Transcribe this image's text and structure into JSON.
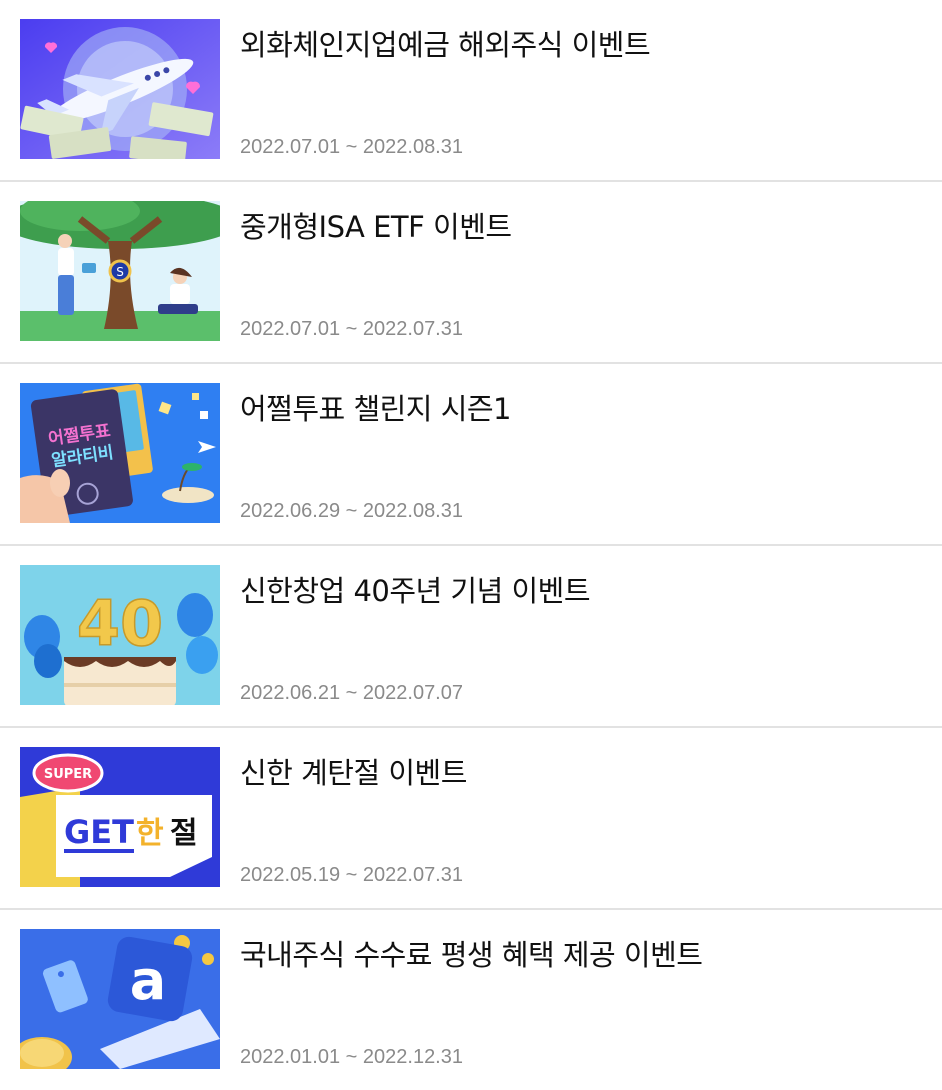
{
  "events": [
    {
      "title": "외화체인지업예금 해외주식 이벤트",
      "period": "2022.07.01 ~ 2022.08.31",
      "thumbnail": "airplane-money-banner"
    },
    {
      "title": "중개형ISA ETF 이벤트",
      "period": "2022.07.01 ~ 2022.07.31",
      "thumbnail": "tree-watering-banner"
    },
    {
      "title": "어쩔투표 챌린지 시즌1",
      "period": "2022.06.29 ~ 2022.08.31",
      "thumbnail": "passport-travel-banner",
      "thumbnail_text": [
        "어쩔투표",
        "알라티비"
      ]
    },
    {
      "title": "신한창업 40주년 기념 이벤트",
      "period": "2022.06.21 ~ 2022.07.07",
      "thumbnail": "birthday-cake-40-banner",
      "thumbnail_text": "40"
    },
    {
      "title": "신한 계탄절 이벤트",
      "period": "2022.05.19 ~ 2022.07.31",
      "thumbnail": "super-get-banner",
      "thumbnail_text": [
        "SUPER",
        "GET",
        "한",
        "절"
      ]
    },
    {
      "title": "국내주식 수수료 평생 혜택 제공 이벤트",
      "period": "2022.01.01 ~ 2022.12.31",
      "thumbnail": "app-coin-banner",
      "thumbnail_text": "a"
    }
  ]
}
